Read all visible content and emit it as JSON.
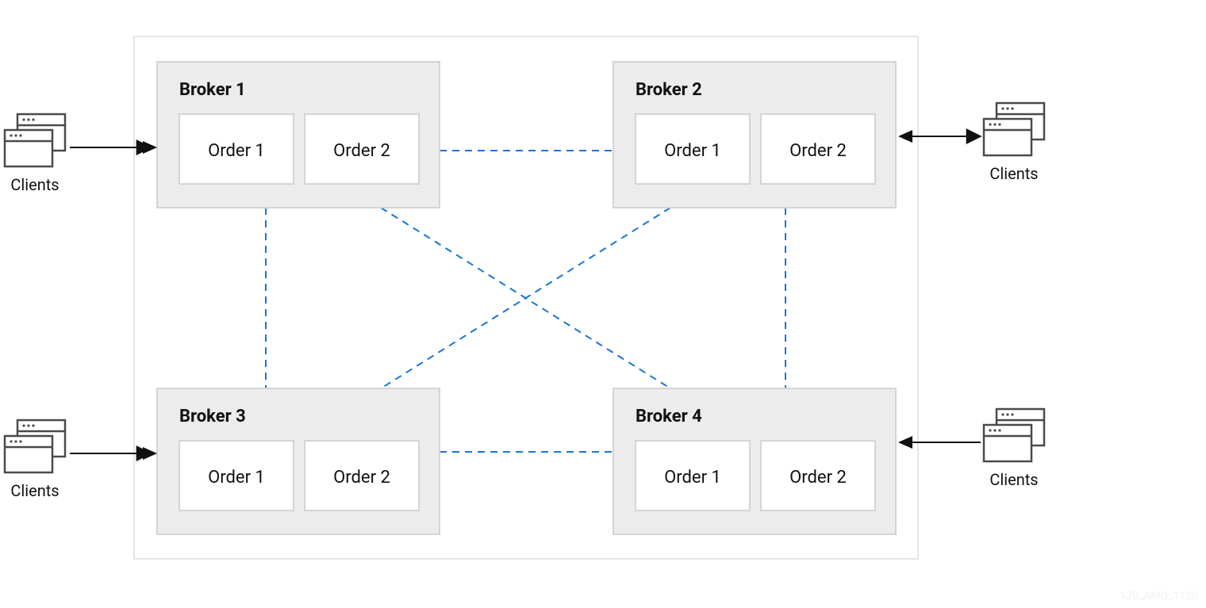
{
  "dashed_color": "#1b73d6",
  "brokers": [
    {
      "title": "Broker 1",
      "orders": [
        "Order 1",
        "Order 2"
      ]
    },
    {
      "title": "Broker 2",
      "orders": [
        "Order 1",
        "Order 2"
      ]
    },
    {
      "title": "Broker 3",
      "orders": [
        "Order 1",
        "Order 2"
      ]
    },
    {
      "title": "Broker 4",
      "orders": [
        "Order 1",
        "Order 2"
      ]
    }
  ],
  "clients_label": "Clients",
  "footer_code": "120_AMQ_1120"
}
